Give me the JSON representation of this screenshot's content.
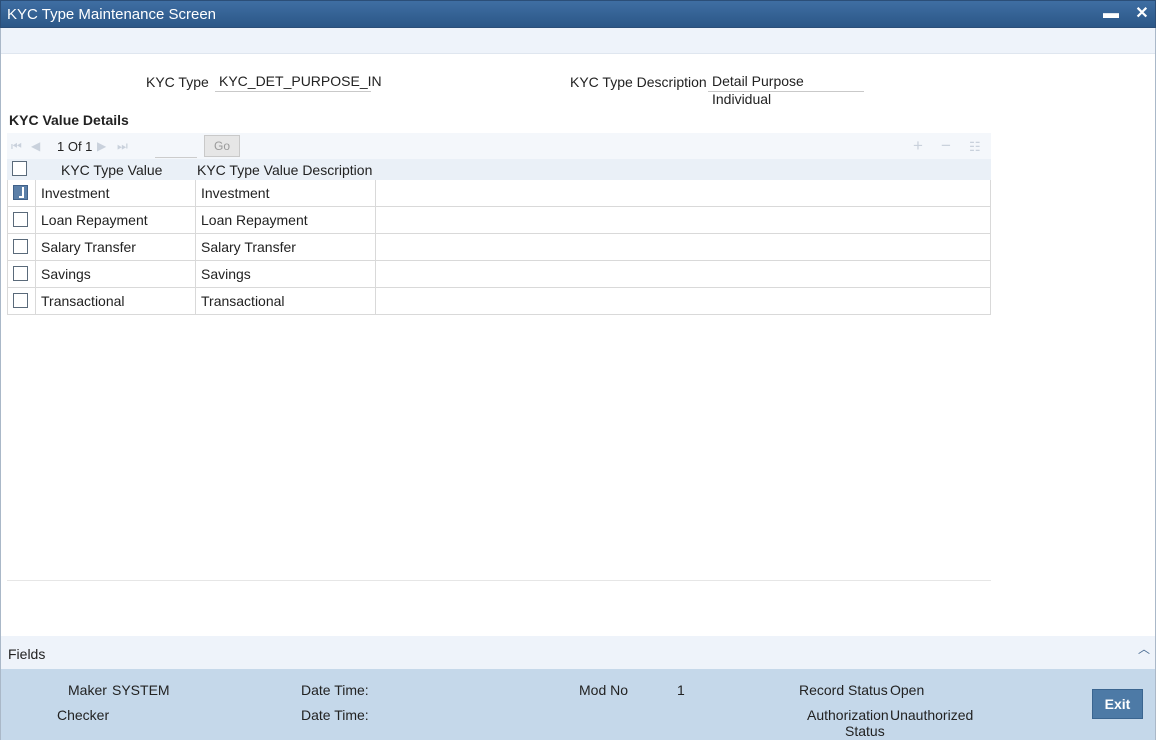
{
  "window": {
    "title": "KYC Type Maintenance Screen",
    "minimize": "▬",
    "close": "✕"
  },
  "form": {
    "kyc_type_label": "KYC Type",
    "kyc_type_value": "KYC_DET_PURPOSE_IN",
    "kyc_desc_label": "KYC Type Description",
    "kyc_desc_value": "Detail Purpose Individual"
  },
  "details": {
    "section_title": "KYC Value Details",
    "pager": {
      "text": "1 Of 1",
      "go_label": "Go"
    },
    "columns": {
      "value": "KYC Type Value",
      "description": "KYC Type Value Description"
    },
    "rows": [
      {
        "value": "Investment",
        "description": "Investment",
        "checked": true
      },
      {
        "value": "Loan Repayment",
        "description": "Loan Repayment",
        "checked": false
      },
      {
        "value": "Salary Transfer",
        "description": "Salary Transfer",
        "checked": false
      },
      {
        "value": "Savings",
        "description": "Savings",
        "checked": false
      },
      {
        "value": "Transactional",
        "description": "Transactional",
        "checked": false
      }
    ]
  },
  "fields_bar": {
    "label": "Fields"
  },
  "audit": {
    "maker_label": "Maker",
    "maker_value": "SYSTEM",
    "checker_label": "Checker",
    "date_time_label_1": "Date Time:",
    "date_time_label_2": "Date Time:",
    "mod_no_label": "Mod No",
    "mod_no_value": "1",
    "record_status_label": "Record Status",
    "record_status_value": "Open",
    "auth_status_label_1": "Authorization",
    "auth_status_label_2": "Status",
    "auth_status_value": "Unauthorized",
    "exit_label": "Exit"
  },
  "colors": {
    "titlebar": "#2b5787",
    "audit_bg": "#c5d8ea",
    "exit_btn": "#4d7aa6",
    "header_bg": "#eaf0f7"
  }
}
